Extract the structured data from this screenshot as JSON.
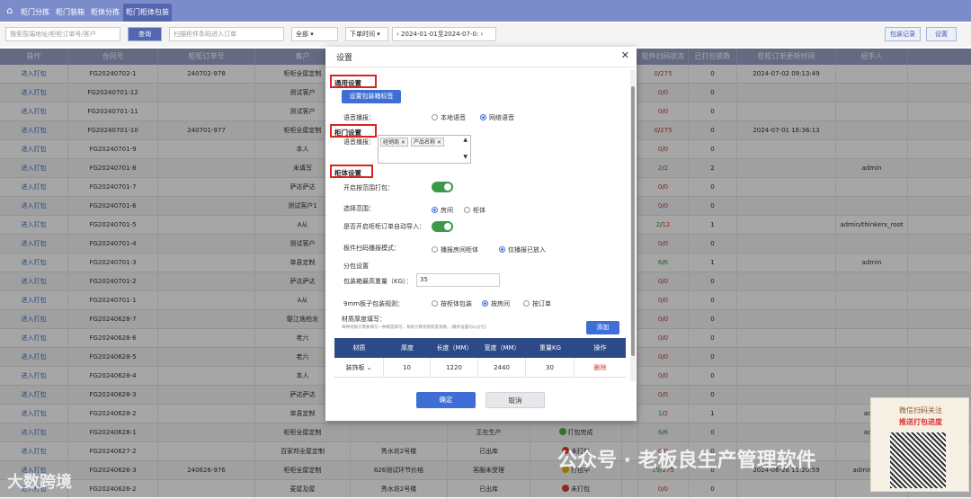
{
  "tabs": [
    "柜门分拣",
    "柜门装箱",
    "柜体分拣",
    "柜门柜体包装"
  ],
  "toolbar": {
    "search_placeholder": "搜索揽端地址/柜柜订单号/客户",
    "search_btn": "查询",
    "scan_placeholder": "扫描柜件条码进入订单",
    "status_select": "全部",
    "time_select": "下单时间",
    "date_range": "2024-01-01至2024-07-0:",
    "pack_record": "包装记录",
    "settings": "设置"
  },
  "columns": [
    "操作",
    "合同号",
    "柜柜订单号",
    "客户",
    "",
    "",
    "",
    "",
    "柜件扫码状态",
    "已打包装数",
    "柜柜订单更新时间",
    "经手人"
  ],
  "rows": [
    {
      "op": "进入打包",
      "contract": "FG20240702-1",
      "order": "240702-978",
      "customer": "柜柜全屋定制",
      "scan": "0/275",
      "packed": "0",
      "updated": "2024-07-02 09:13:49",
      "handler": ""
    },
    {
      "op": "进入打包",
      "contract": "FG20240701-12",
      "order": "",
      "customer": "测试客户",
      "scan": "0/0",
      "packed": "0",
      "updated": "",
      "handler": ""
    },
    {
      "op": "进入打包",
      "contract": "FG20240701-11",
      "order": "",
      "customer": "测试客户",
      "scan": "0/0",
      "packed": "0",
      "updated": "",
      "handler": ""
    },
    {
      "op": "进入打包",
      "contract": "FG20240701-10",
      "order": "240701-977",
      "customer": "柜柜全屋定制",
      "scan": "0/275",
      "packed": "0",
      "updated": "2024-07-01 16:36:13",
      "handler": ""
    },
    {
      "op": "进入打包",
      "contract": "FG20240701-9",
      "order": "",
      "customer": "本人",
      "scan": "0/0",
      "packed": "0",
      "updated": "",
      "handler": ""
    },
    {
      "op": "进入打包",
      "contract": "FG20240701-8",
      "order": "",
      "customer": "未填写",
      "scan": "2/2",
      "packed": "2",
      "updated": "",
      "handler": "admin"
    },
    {
      "op": "进入打包",
      "contract": "FG20240701-7",
      "order": "",
      "customer": "萨达萨达",
      "scan": "0/0",
      "packed": "0",
      "updated": "",
      "handler": ""
    },
    {
      "op": "进入打包",
      "contract": "FG20240701-6",
      "order": "",
      "customer": "测试客户1",
      "scan": "0/0",
      "packed": "0",
      "updated": "",
      "handler": ""
    },
    {
      "op": "进入打包",
      "contract": "FG20240701-5",
      "order": "",
      "customer": "A从",
      "scan": "2/12",
      "packed": "1",
      "updated": "",
      "handler": "admin/thinkerx_root"
    },
    {
      "op": "进入打包",
      "contract": "FG20240701-4",
      "order": "",
      "customer": "测试客户",
      "scan": "0/0",
      "packed": "0",
      "updated": "",
      "handler": ""
    },
    {
      "op": "进入打包",
      "contract": "FG20240701-3",
      "order": "",
      "customer": "单县定制",
      "scan": "6/6",
      "packed": "1",
      "updated": "",
      "handler": "admin"
    },
    {
      "op": "进入打包",
      "contract": "FG20240701-2",
      "order": "",
      "customer": "萨达萨达",
      "scan": "0/0",
      "packed": "0",
      "updated": "",
      "handler": ""
    },
    {
      "op": "进入打包",
      "contract": "FG20240701-1",
      "order": "",
      "customer": "A从",
      "scan": "0/0",
      "packed": "0",
      "updated": "",
      "handler": ""
    },
    {
      "op": "进入打包",
      "contract": "FG20240628-7",
      "order": "",
      "customer": "駆江逸柏龙",
      "scan": "0/0",
      "packed": "0",
      "updated": "",
      "handler": ""
    },
    {
      "op": "进入打包",
      "contract": "FG20240628-6",
      "order": "",
      "customer": "老六",
      "scan": "0/0",
      "packed": "0",
      "updated": "",
      "handler": ""
    },
    {
      "op": "进入打包",
      "contract": "FG20240628-5",
      "order": "",
      "customer": "老六",
      "scan": "0/0",
      "packed": "0",
      "updated": "",
      "handler": ""
    },
    {
      "op": "进入打包",
      "contract": "FG20240628-4",
      "order": "",
      "customer": "本人",
      "scan": "0/0",
      "packed": "0",
      "updated": "",
      "handler": ""
    },
    {
      "op": "进入打包",
      "contract": "FG20240628-3",
      "order": "",
      "customer": "萨达萨达",
      "scan": "0/0",
      "packed": "0",
      "updated": "",
      "handler": ""
    },
    {
      "op": "进入打包",
      "contract": "FG20240628-2",
      "order": "",
      "customer": "单县定制",
      "scan": "1/2",
      "packed": "1",
      "updated": "",
      "handler": "admi"
    },
    {
      "op": "进入打包",
      "contract": "FG20240628-1",
      "order": "",
      "customer": "柜柜全屋定制",
      "scan": "6/6",
      "packed": "0",
      "updated": "",
      "handler": "admi",
      "c5": "",
      "c6": "正在生产",
      "c7": "打包完成",
      "dot": "#4caf50"
    },
    {
      "op": "进入打包",
      "contract": "FG20240627-2",
      "order": "",
      "customer": "百家邦全屋定制",
      "scan": "0/0",
      "packed": "0",
      "updated": "",
      "handler": "",
      "c5": "秀水坊2号楼",
      "c6": "已出库",
      "c7": "未打包",
      "dot": "#e53935"
    },
    {
      "op": "进入打包",
      "contract": "FG20240626-3",
      "order": "240626-976",
      "customer": "柜柜全屋定制",
      "scan": "19/275",
      "packed": "0",
      "updated": "2024-06-26 11:20:59",
      "handler": "admin/think",
      "c5": "626测试环节价格",
      "c6": "客服未受理",
      "c7": "打包中",
      "dot": "#f0b400"
    },
    {
      "op": "进入打包",
      "contract": "FG20240626-2",
      "order": "",
      "customer": "麦屋及屋",
      "scan": "0/0",
      "packed": "0",
      "updated": "",
      "handler": "",
      "c5": "秀水坊2号楼",
      "c6": "已出库",
      "c7": "未打包",
      "dot": "#e53935"
    }
  ],
  "modal": {
    "title": "设置",
    "close": "✕",
    "sec_general": "通用设置",
    "btn_pack_label": "设置包装箱标签",
    "voice_label": "语音播报：",
    "voice_local": "本地语音",
    "voice_net": "网络语音",
    "sec_door": "柜门设置",
    "door_voice_label": "语音播报：",
    "tags": [
      "经销商",
      "产品名称"
    ],
    "sec_cabinet": "柜体设置",
    "range_pack_label": "开启按范围打包：",
    "range_label": "选择范围：",
    "range_room": "房间",
    "range_cabinet": "柜体",
    "auto_import_label": "是否开启柜柜订单自动导入：",
    "scan_mode_label": "板件扫码播报模式：",
    "scan_mode_a": "播报房间柜体",
    "scan_mode_b": "仅播报已放入",
    "split_label": "分包设置",
    "max_weight_label": "包装箱最高重量（KG）：",
    "max_weight_value": "35",
    "rule_label": "9mm板子包装规则：",
    "rule_a": "按柜体包装",
    "rule_b": "按房间",
    "rule_c": "按订单",
    "thick_label": "材质厚度填写：",
    "thick_note": "每种材质只需要填写一种厚度即可，系统计算其他厚度系数。(最终设置均以分包)",
    "add_btn": "添加",
    "table_headers": [
      "材质",
      "厚度",
      "长度（MM）",
      "宽度（MM）",
      "重量KG",
      "操作"
    ],
    "table_row": {
      "material": "装饰板",
      "thickness": "10",
      "length": "1220",
      "width": "2440",
      "weight": "30",
      "op": "删除"
    },
    "confirm": "确定",
    "cancel": "取消"
  },
  "watermark": {
    "left": "大数跨境",
    "right": "公众号 · 老板良生产管理软件"
  },
  "promo": {
    "line1": "微信扫码关注",
    "line2": "推送打包进度"
  }
}
